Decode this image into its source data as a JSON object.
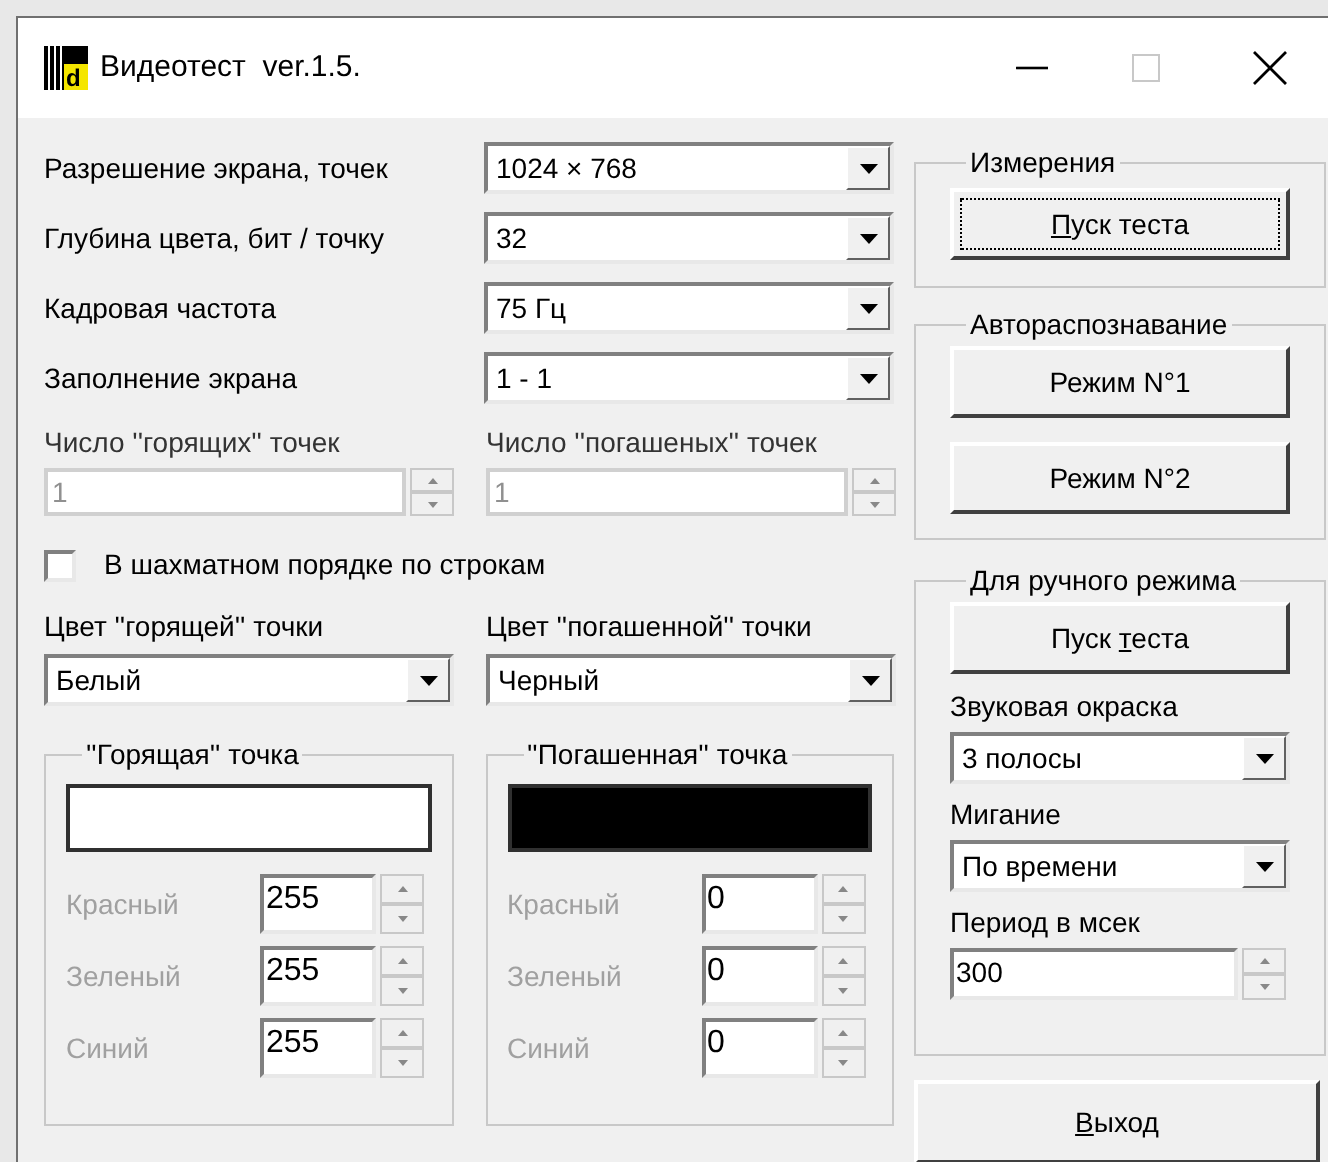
{
  "window": {
    "title": "Видеотест  ver.1.5.",
    "icon_letter": "d"
  },
  "settings": [
    {
      "label": "Разрешение экрана, точек",
      "value": "1024 × 768"
    },
    {
      "label": "Глубина цвета, бит / точку",
      "value": "32"
    },
    {
      "label": "Кадровая частота",
      "value": "75 Гц"
    },
    {
      "label": "Заполнение экрана",
      "value": "1 - 1"
    }
  ],
  "point_counts": [
    {
      "label": "Число ''горящих'' точек",
      "value": "1",
      "disabled": true
    },
    {
      "label": "Число ''погашеных'' точек",
      "value": "1",
      "disabled": true
    }
  ],
  "checkerboard": {
    "label": "В шахматном порядке по строкам",
    "checked": false
  },
  "color_selectors": [
    {
      "label": "Цвет ''горящей'' точки",
      "value": "Белый"
    },
    {
      "label": "Цвет ''погашенной'' точки",
      "value": "Черный"
    }
  ],
  "point_groups": [
    {
      "title": "''Горящая'' точка",
      "color": "#ffffff",
      "channels": [
        {
          "label": "Красный",
          "value": "255",
          "disabled": true
        },
        {
          "label": "Зеленый",
          "value": "255",
          "disabled": true
        },
        {
          "label": "Синий",
          "value": "255",
          "disabled": true
        }
      ]
    },
    {
      "title": "''Погашенная'' точка",
      "color": "#000000",
      "channels": [
        {
          "label": "Красный",
          "value": "0",
          "disabled": true
        },
        {
          "label": "Зеленый",
          "value": "0",
          "disabled": true
        },
        {
          "label": "Синий",
          "value": "0",
          "disabled": true
        }
      ]
    }
  ],
  "measurement": {
    "title": "Измерения",
    "button": {
      "key": "П",
      "post": "уск теста",
      "focused": true
    }
  },
  "autodetect": {
    "title": "Автораспознавание",
    "buttons": [
      {
        "pre": "Режим N°1",
        "focused": false
      },
      {
        "pre": "Режим N°2",
        "focused": false
      }
    ]
  },
  "manual": {
    "title": "Для ручного режима",
    "button": {
      "pre": "Пуск ",
      "key": "т",
      "post": "еста",
      "focused": false
    },
    "sound": {
      "label": "Звуковая окраска",
      "value": "3 полосы"
    },
    "blink": {
      "label": "Мигание",
      "value": "По времени"
    },
    "period": {
      "label": "Период в мсек",
      "value": "300"
    }
  },
  "exit_button": {
    "key": "В",
    "post": "ыход",
    "focused": false
  }
}
